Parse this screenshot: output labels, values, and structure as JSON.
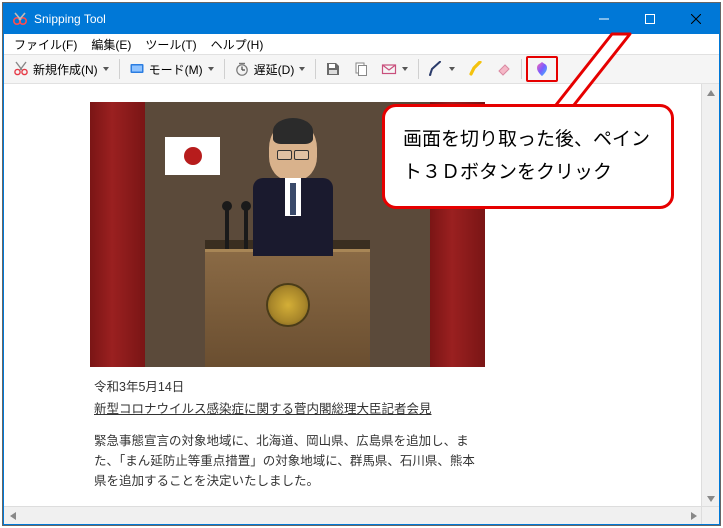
{
  "window": {
    "title": "Snipping Tool"
  },
  "menu": {
    "file": "ファイル(F)",
    "edit": "編集(E)",
    "tools": "ツール(T)",
    "help": "ヘルプ(H)"
  },
  "toolbar": {
    "new_label": "新規作成(N)",
    "mode_label": "モード(M)",
    "delay_label": "遅延(D)"
  },
  "snip": {
    "date": "令和3年5月14日",
    "headline": "新型コロナウイルス感染症に関する菅内閣総理大臣記者会見",
    "body": "緊急事態宣言の対象地域に、北海道、岡山県、広島県を追加し、また、「まん延防止等重点措置」の対象地域に、群馬県、石川県、熊本県を追加することを決定いたしました。"
  },
  "callout": {
    "text": "画面を切り取った後、ペイント３Ｄボタンをクリック"
  }
}
